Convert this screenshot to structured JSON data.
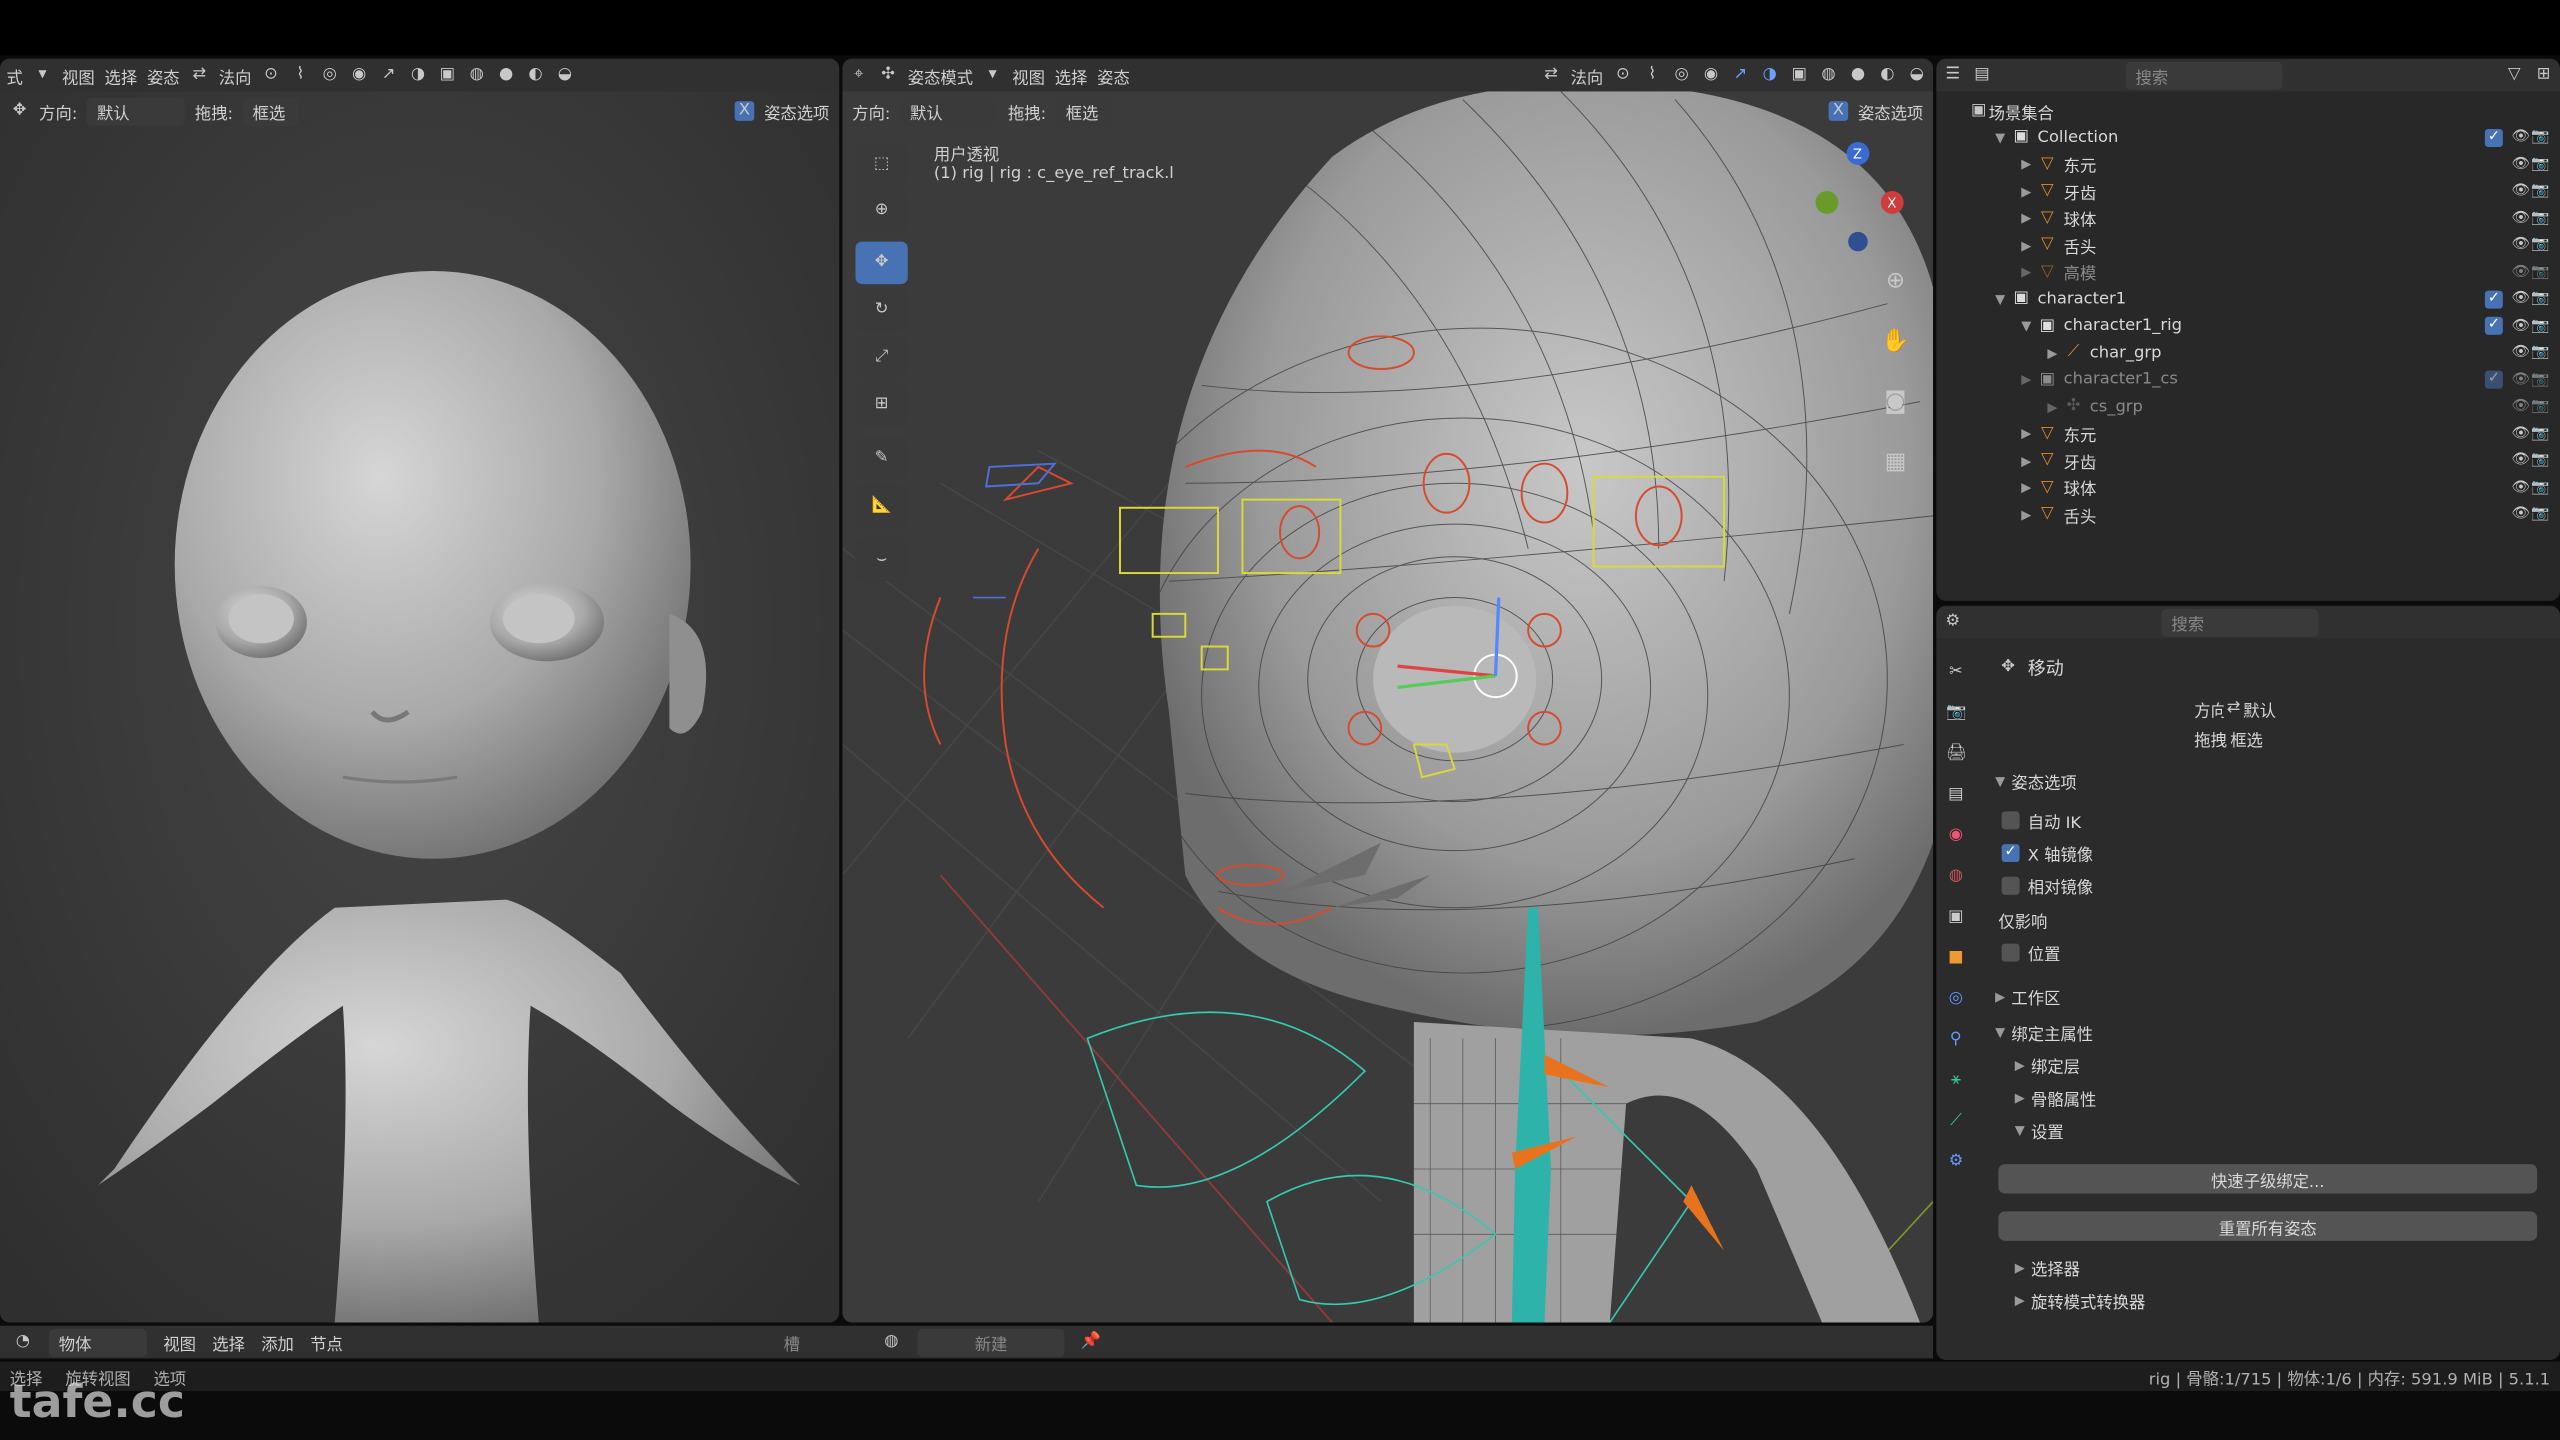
{
  "watermark": "tafe.cc",
  "left_view": {
    "menus": [
      "式",
      "视图",
      "选择",
      "姿态"
    ],
    "orientation_label": "法向",
    "orient_label": "方向:",
    "orient_value": "默认",
    "drag_label": "拖拽:",
    "drag_value": "框选",
    "pose_options": "姿态选项",
    "x_label": "X"
  },
  "main_view": {
    "mode": "姿态模式",
    "menus": [
      "视图",
      "选择",
      "姿态"
    ],
    "orientation_label": "法向",
    "orient_label": "方向:",
    "orient_value": "默认",
    "drag_label": "拖拽:",
    "drag_value": "框选",
    "pose_options": "姿态选项",
    "x_label": "X",
    "view_name": "用户透视",
    "view_info": "(1) rig | rig : c_eye_ref_track.l"
  },
  "outliner": {
    "search_placeholder": "搜索",
    "scene": "场景集合",
    "items": [
      {
        "name": "Collection",
        "indent": 0,
        "type": "collection"
      },
      {
        "name": "东元",
        "indent": 1,
        "type": "mesh"
      },
      {
        "name": "牙齿",
        "indent": 1,
        "type": "mesh"
      },
      {
        "name": "球体",
        "indent": 1,
        "type": "mesh"
      },
      {
        "name": "舌头",
        "indent": 1,
        "type": "mesh"
      },
      {
        "name": "高模",
        "indent": 1,
        "type": "mesh",
        "dim": true
      },
      {
        "name": "character1",
        "indent": 0,
        "type": "collection"
      },
      {
        "name": "character1_rig",
        "indent": 1,
        "type": "collection"
      },
      {
        "name": "char_grp",
        "indent": 2,
        "type": "armature"
      },
      {
        "name": "character1_cs",
        "indent": 1,
        "type": "collection",
        "dim": true
      },
      {
        "name": "cs_grp",
        "indent": 2,
        "type": "empty",
        "dim": true
      },
      {
        "name": "东元",
        "indent": 1,
        "type": "mesh"
      },
      {
        "name": "牙齿",
        "indent": 1,
        "type": "mesh"
      },
      {
        "name": "球体",
        "indent": 1,
        "type": "mesh"
      },
      {
        "name": "舌头",
        "indent": 1,
        "type": "mesh"
      }
    ]
  },
  "properties": {
    "search_placeholder": "搜索",
    "tool_name": "移动",
    "orientation_label": "方向",
    "orientation_value": "默认",
    "drag_label": "拖拽",
    "drag_value": "框选",
    "pose_options": "姿态选项",
    "auto_ik": "自动 IK",
    "x_mirror": "X 轴镜像",
    "relative_mirror": "相对镜像",
    "affect_only": "仅影响",
    "location": "位置",
    "workspace": "工作区",
    "rig_main": "绑定主属性",
    "rig_layers": "绑定层",
    "bone_props": "骨骼属性",
    "settings": "设置",
    "quick_child": "快速子级绑定...",
    "reset_pose": "重置所有姿态",
    "selector": "选择器",
    "rot_mode": "旋转模式转换器"
  },
  "bottom_bar": {
    "editor": "物体",
    "menus": [
      "视图",
      "选择",
      "添加",
      "节点"
    ],
    "slot": "槽",
    "new_label": "新建"
  },
  "status": {
    "left": [
      "选择",
      "旋转视图",
      "选项"
    ],
    "right": "rig | 骨骼:1/715 | 物体:1/6 | 内存: 591.9 MiB | 5.1.1"
  }
}
